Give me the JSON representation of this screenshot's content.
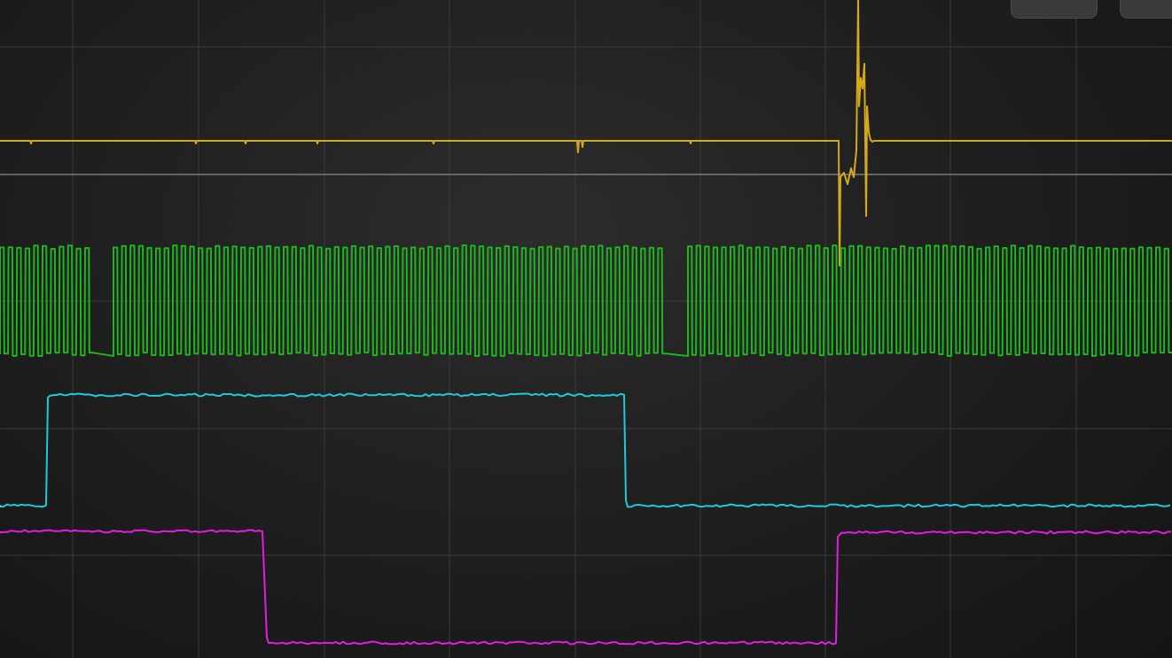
{
  "display": {
    "background": "#1f1f1f",
    "grid_color": "#3a3a3a",
    "reference_line_color": "#8a8a8a"
  },
  "channels": [
    {
      "id": "ch1",
      "color": "#d4a91a",
      "kind": "supply-with-spike"
    },
    {
      "id": "ch2",
      "color": "#1fb51f",
      "kind": "clock-bursts"
    },
    {
      "id": "ch3",
      "color": "#1fc8dc",
      "kind": "single-pulse-high"
    },
    {
      "id": "ch4",
      "color": "#e01ee0",
      "kind": "single-pulse-low"
    }
  ],
  "top_buttons": [
    {
      "name": "menu-button-a"
    },
    {
      "name": "menu-button-b"
    }
  ]
}
